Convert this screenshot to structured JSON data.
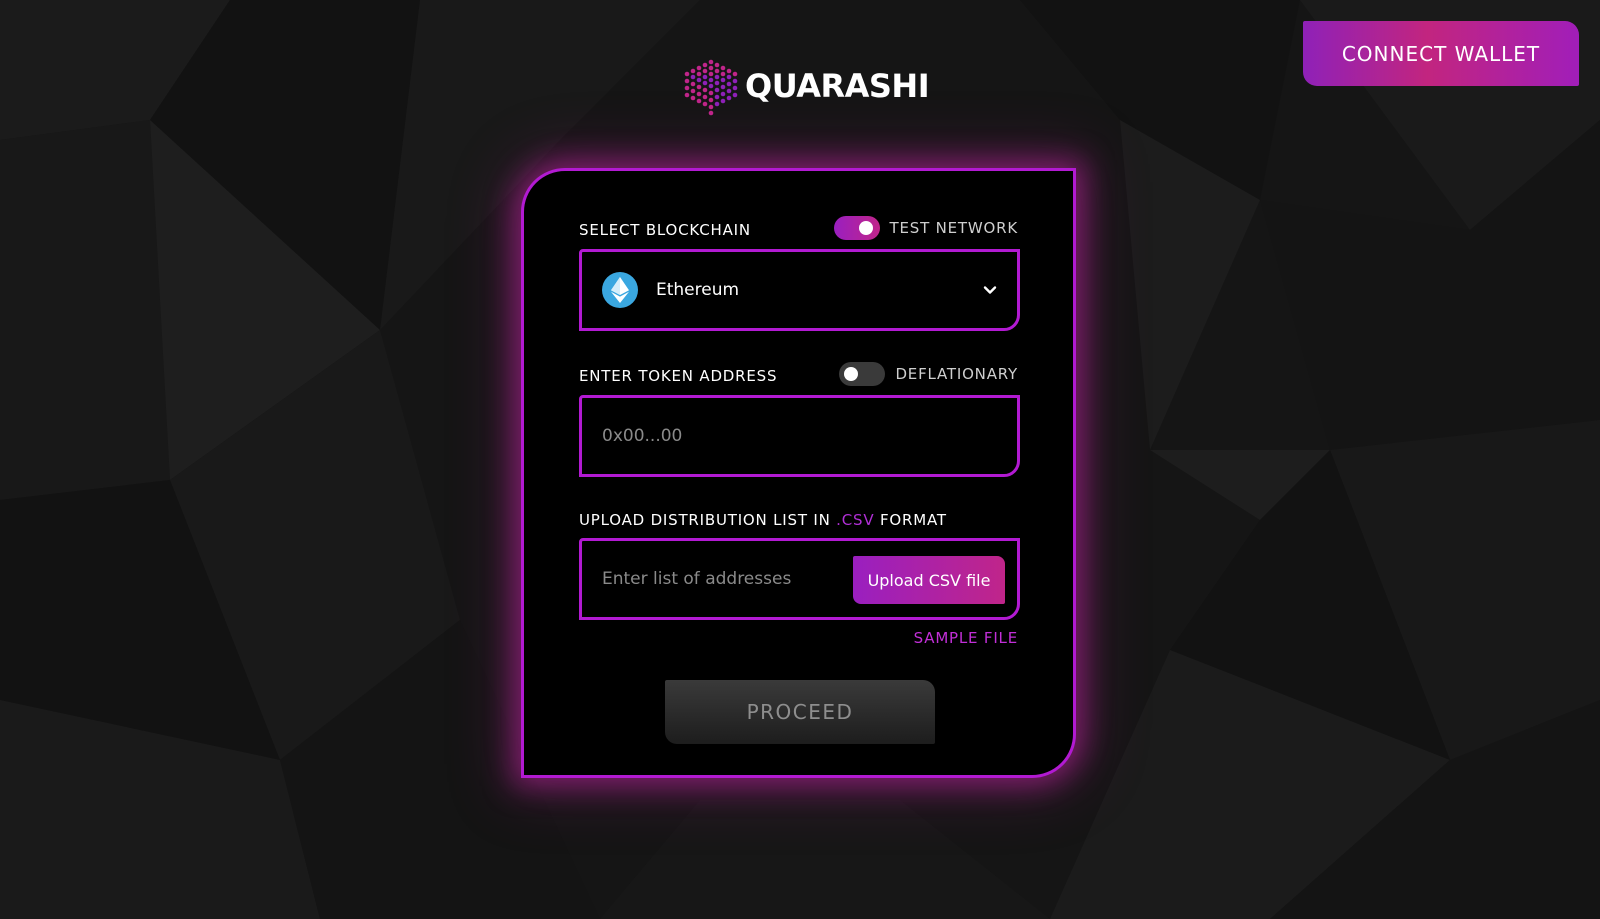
{
  "header": {
    "brand_name": "QUARASHI",
    "connect_wallet_label": "CONNECT WALLET"
  },
  "blockchain": {
    "label": "SELECT BLOCKCHAIN",
    "test_network_label": "TEST NETWORK",
    "test_network_on": true,
    "selected": "Ethereum",
    "selected_icon": "ethereum-icon"
  },
  "token": {
    "label": "ENTER TOKEN ADDRESS",
    "deflationary_label": "DEFLATIONARY",
    "deflationary_on": false,
    "placeholder": "0x00...00",
    "value": ""
  },
  "distribution": {
    "label_prefix": "UPLOAD DISTRIBUTION LIST IN ",
    "label_format": ".CSV",
    "label_suffix": " FORMAT",
    "placeholder": "Enter list of addresses",
    "upload_label": "Upload CSV file",
    "sample_link_label": "SAMPLE FILE"
  },
  "actions": {
    "proceed_label": "PROCEED"
  },
  "colors": {
    "accent": "#b21ad2",
    "accent_pink": "#c0258a",
    "ethereum": "#3aa7e0",
    "background": "#151515"
  }
}
